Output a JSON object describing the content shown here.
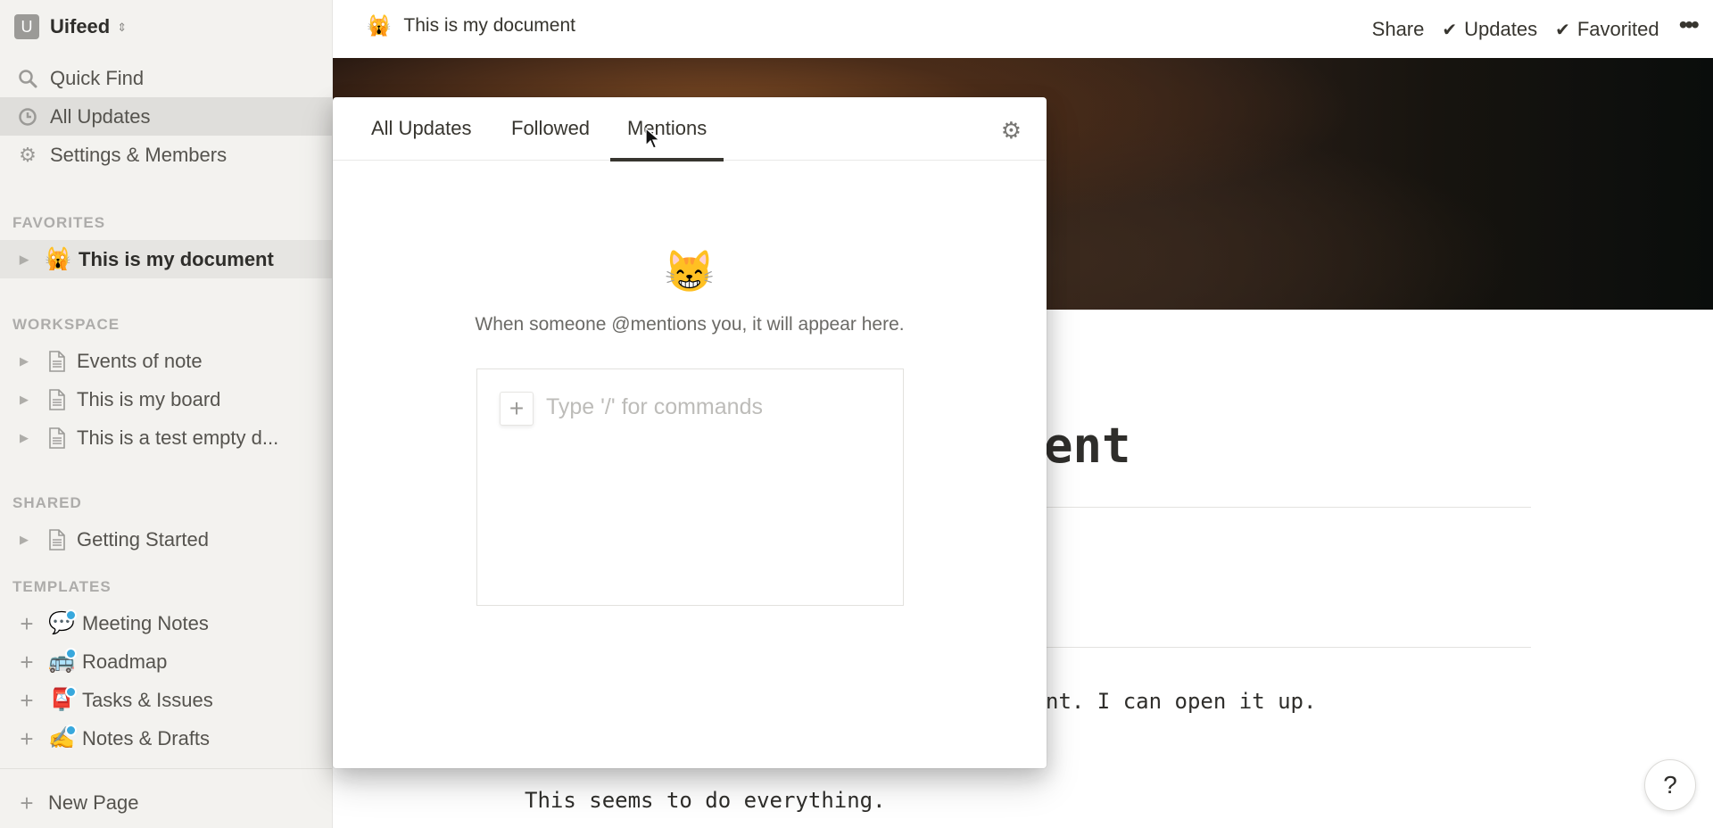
{
  "workspace": {
    "initial": "U",
    "name": "Uifeed"
  },
  "nav": [
    {
      "label": "Quick Find",
      "icon": "search-icon",
      "glyph": "⚲"
    },
    {
      "label": "All Updates",
      "icon": "clock-icon",
      "glyph": "◷",
      "active": true
    },
    {
      "label": "Settings & Members",
      "icon": "gear-icon",
      "glyph": "⚙"
    }
  ],
  "sections": {
    "favorites": "FAVORITES",
    "workspace": "WORKSPACE",
    "shared": "SHARED",
    "templates": "TEMPLATES"
  },
  "favorites": [
    {
      "label": "This is my document",
      "emoji": "🙀"
    }
  ],
  "workspace_pages": [
    {
      "label": "Events of note"
    },
    {
      "label": "This is my board"
    },
    {
      "label": "This is a test empty d..."
    }
  ],
  "shared_pages": [
    {
      "label": "Getting Started"
    }
  ],
  "templates": [
    {
      "label": "Meeting Notes",
      "emoji": "💬"
    },
    {
      "label": "Roadmap",
      "emoji": "🚌"
    },
    {
      "label": "Tasks & Issues",
      "emoji": "📮"
    },
    {
      "label": "Notes & Drafts",
      "emoji": "✍️"
    }
  ],
  "new_page_label": "New Page",
  "topbar": {
    "page_emoji": "🙀",
    "page_title": "This is my document",
    "share": "Share",
    "updates": "Updates",
    "favorited": "Favorited",
    "more": "•••"
  },
  "document": {
    "title_visible": "ent",
    "para1_visible": "nt. I can open it up.",
    "para2": "This seems to do everything."
  },
  "updates_popup": {
    "tabs": [
      "All Updates",
      "Followed",
      "Mentions"
    ],
    "active_tab": "Mentions",
    "empty_emoji": "😸",
    "empty_text": "When someone @mentions you, it will appear here.",
    "editor_placeholder": "Type '/' for commands",
    "editor_value": ""
  },
  "help_label": "?"
}
